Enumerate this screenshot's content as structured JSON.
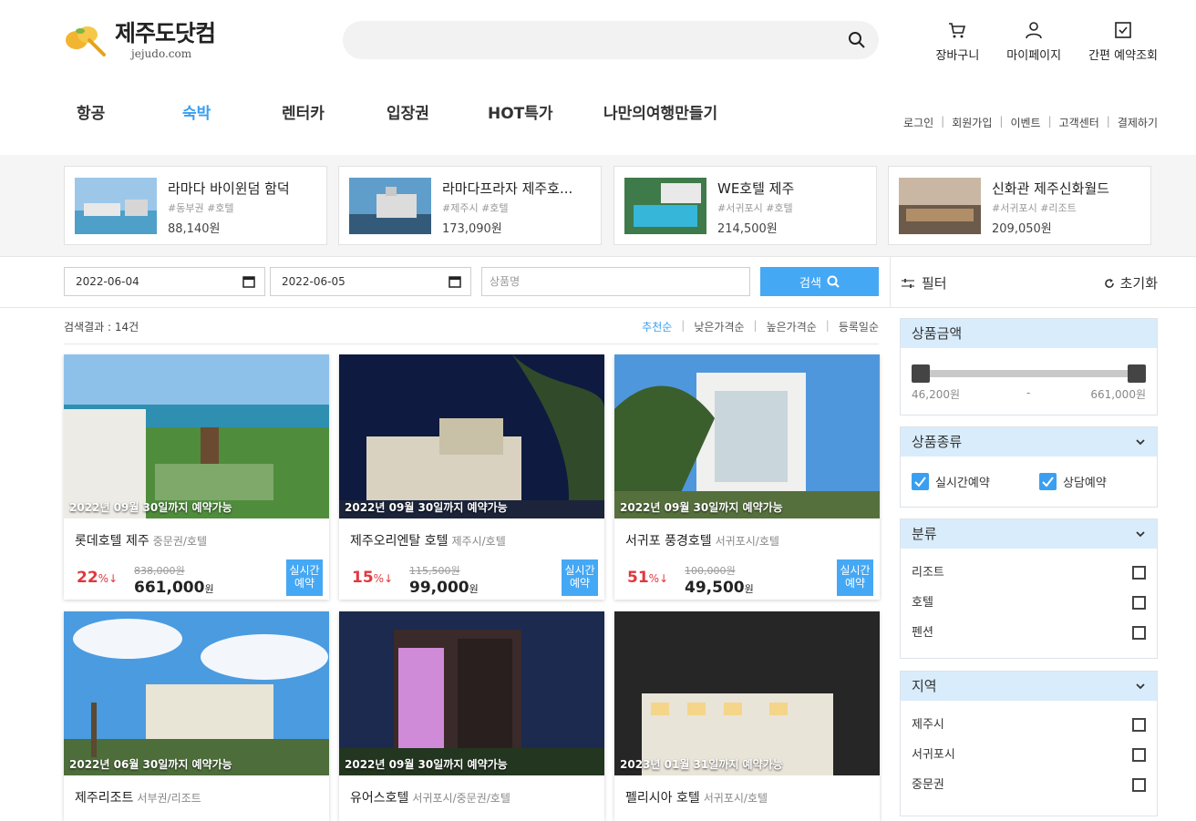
{
  "header": {
    "logo_title": "제주도닷컴",
    "logo_sub": "jejudo.com",
    "top_links": [
      {
        "label": "장바구니",
        "icon": "cart-icon"
      },
      {
        "label": "마이페이지",
        "icon": "user-icon"
      },
      {
        "label": "간편 예약조회",
        "icon": "check-square-icon"
      }
    ],
    "nav": [
      "항공",
      "숙박",
      "렌터카",
      "입장권",
      "HOT특가",
      "나만의여행만들기"
    ],
    "nav_active": "숙박",
    "util": [
      "로그인",
      "회원가입",
      "이벤트",
      "고객센터",
      "결제하기"
    ]
  },
  "featured": [
    {
      "name": "라마다 바이윈덤 함덕",
      "tags": "#동부권 #호텔",
      "price": "88,140원"
    },
    {
      "name": "라마다프라자 제주호...",
      "tags": "#제주시 #호텔",
      "price": "173,090원"
    },
    {
      "name": "WE호텔 제주",
      "tags": "#서귀포시 #호텔",
      "price": "214,500원"
    },
    {
      "name": "신화관 제주신화월드",
      "tags": "#서귀포시 #리조트",
      "price": "209,050원"
    }
  ],
  "search": {
    "checkin": "2022-06-04",
    "checkout": "2022-06-05",
    "product_placeholder": "상품명",
    "button": "검색",
    "filter_label": "필터",
    "reset_label": "초기화"
  },
  "results": {
    "count_text": "검색결과 : 14건",
    "sort": [
      "추천순",
      "낮은가격순",
      "높은가격순",
      "등록일순"
    ],
    "sort_active": "추천순"
  },
  "products": [
    {
      "avail": "2022년 09월 30일까지 예약가능",
      "name": "롯데호텔 제주",
      "loc": "중문권/호텔",
      "disc": "22",
      "orig": "838,000원",
      "price": "661,000",
      "badge": "실시간\n예약"
    },
    {
      "avail": "2022년 09월 30일까지 예약가능",
      "name": "제주오리엔탈 호텔",
      "loc": "제주시/호텔",
      "disc": "15",
      "orig": "115,500원",
      "price": "99,000",
      "badge": "실시간\n예약"
    },
    {
      "avail": "2022년 09월 30일까지 예약가능",
      "name": "서귀포 풍경호텔",
      "loc": "서귀포시/호텔",
      "disc": "51",
      "orig": "100,000원",
      "price": "49,500",
      "badge": "실시간\n예약"
    },
    {
      "avail": "2022년 06월 30일까지 예약가능",
      "name": "제주리조트",
      "loc": "서부권/리조트"
    },
    {
      "avail": "2022년 09월 30일까지 예약가능",
      "name": "유어스호텔",
      "loc": "서귀포시/중문권/호텔"
    },
    {
      "avail": "2023년 01월 31일까지 예약가능",
      "name": "펠리시아 호텔",
      "loc": "서귀포시/호텔"
    }
  ],
  "price_unit": "원",
  "percent_unit": "%↓",
  "filters": {
    "price": {
      "title": "상품금액",
      "min": "46,200원",
      "dash": "-",
      "max": "661,000원"
    },
    "type": {
      "title": "상품종류",
      "options": [
        "실시간예약",
        "상담예약"
      ]
    },
    "category": {
      "title": "분류",
      "options": [
        "리조트",
        "호텔",
        "펜션"
      ]
    },
    "region": {
      "title": "지역",
      "options": [
        "제주시",
        "서귀포시",
        "중문권"
      ]
    }
  },
  "colors": {
    "accent": "#45a8f5",
    "discount": "#e0383e",
    "filter_head": "#d9ecfb"
  }
}
